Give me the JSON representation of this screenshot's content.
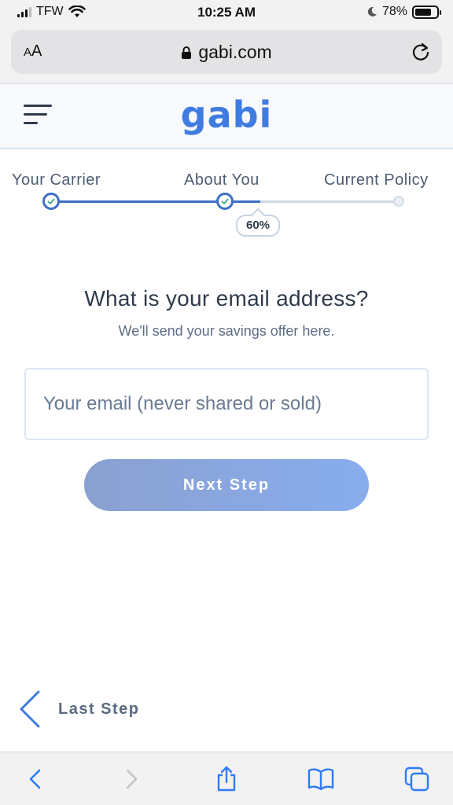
{
  "status_bar": {
    "carrier": "TFW",
    "time": "10:25 AM",
    "battery": "78%",
    "battery_level": 0.78
  },
  "browser": {
    "text_size_label": "AA",
    "url": "gabi.com"
  },
  "site": {
    "logo": "gabi"
  },
  "progress": {
    "steps": [
      "Your Carrier",
      "About You",
      "Current Policy"
    ],
    "percent_label": "60%",
    "percent": 60
  },
  "form": {
    "question": "What is your email address?",
    "subtext": "We'll send your savings offer here.",
    "email_placeholder": "Your email (never shared or sold)",
    "email_value": "",
    "next_button": "Next Step",
    "back_link": "Last Step"
  },
  "colors": {
    "brand": "#3f7be0",
    "progress": "#3f6fc6",
    "button_start": "#8aa0d0",
    "button_end": "#88adee"
  },
  "icons": {
    "browser_toolbar": [
      "back-icon",
      "forward-icon",
      "share-icon",
      "bookmarks-icon",
      "tabs-icon"
    ]
  }
}
